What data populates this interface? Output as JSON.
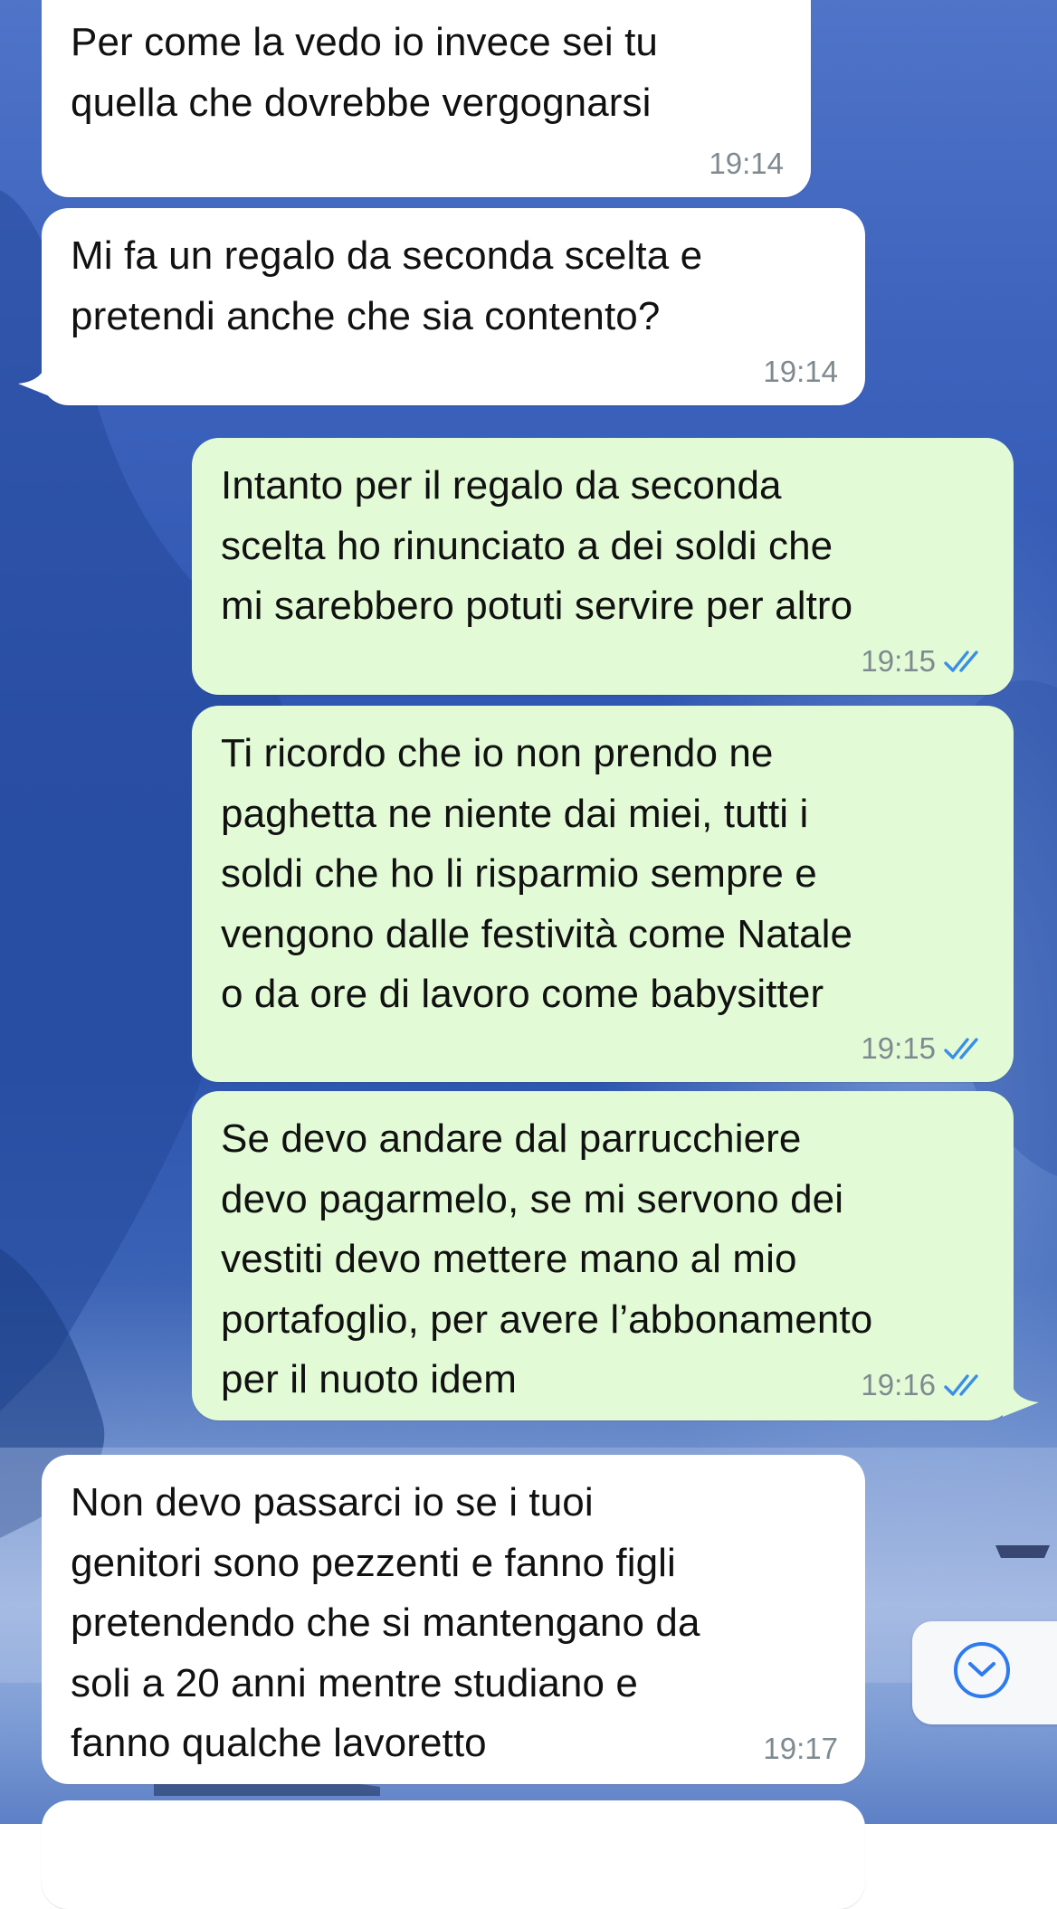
{
  "chat": {
    "messages": [
      {
        "direction": "incoming",
        "text": "Per come la vedo io invece sei tu\nquella che dovrebbe vergognarsi",
        "time": "19:14"
      },
      {
        "direction": "incoming",
        "text": "Mi fa un regalo da seconda scelta e\npretendi anche che sia contento?",
        "time": "19:14"
      },
      {
        "direction": "outgoing",
        "text": "Intanto per il regalo da seconda\nscelta ho rinunciato a dei soldi che\nmi sarebbero potuti servire per altro",
        "time": "19:15",
        "status": "read"
      },
      {
        "direction": "outgoing",
        "text": "Ti ricordo che io non prendo ne\npaghetta ne niente dai miei, tutti i\nsoldi che ho li risparmio sempre e\nvengono dalle festività come Natale\no da ore di lavoro come babysitter",
        "time": "19:15",
        "status": "read"
      },
      {
        "direction": "outgoing",
        "text": "Se devo andare dal parrucchiere\ndevo pagarmelo, se mi servono dei\nvestiti devo mettere mano al mio\nportafoglio, per avere l’abbonamento\nper il nuoto idem",
        "time": "19:16",
        "status": "read"
      },
      {
        "direction": "incoming",
        "text": "Non devo passarci io se i tuoi\ngenitori sono pezzenti e fanno figli\npretendendo che si mantengano da\nsoli a 20 anni mentre studiano e\nfanno qualche lavoretto",
        "time": "19:17"
      }
    ]
  },
  "colors": {
    "incoming_bubble": "#ffffff",
    "outgoing_bubble": "#e2fbd6",
    "read_ticks": "#3b8ee8",
    "scroll_button_accent": "#2e7bf0"
  },
  "icons": {
    "read_receipt": "double-check-icon",
    "scroll_down": "chevron-down-icon"
  }
}
